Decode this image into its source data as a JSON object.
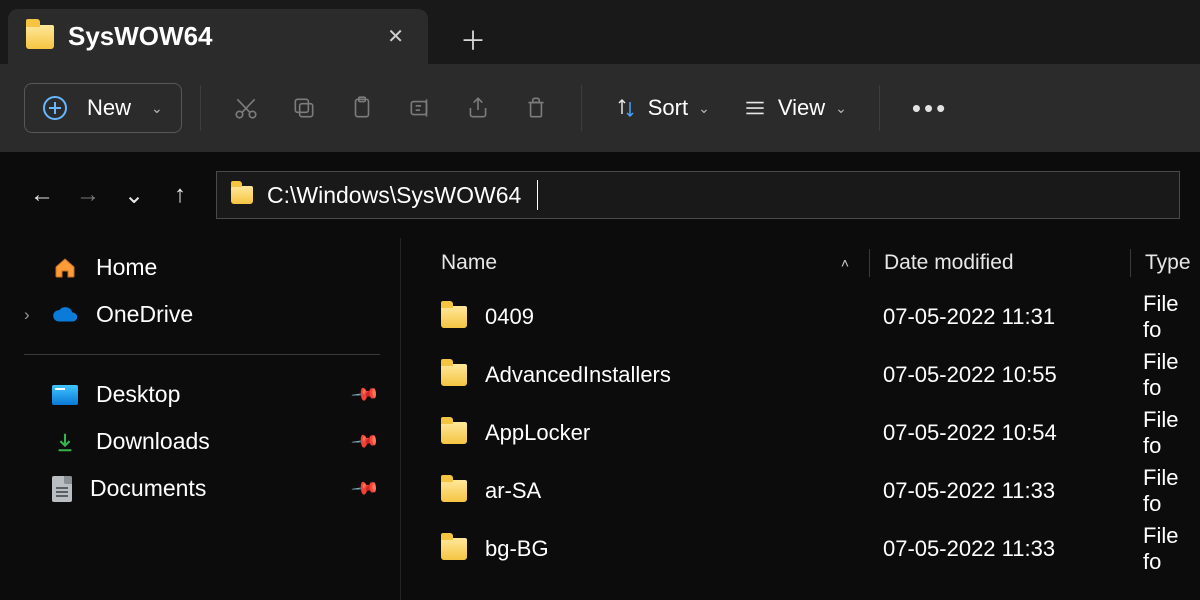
{
  "tab": {
    "title": "SysWOW64"
  },
  "toolbar": {
    "new_label": "New",
    "sort_label": "Sort",
    "view_label": "View"
  },
  "address": {
    "path": "C:\\Windows\\SysWOW64"
  },
  "sidebar": {
    "home": "Home",
    "onedrive": "OneDrive",
    "pinned": [
      {
        "label": "Desktop"
      },
      {
        "label": "Downloads"
      },
      {
        "label": "Documents"
      }
    ]
  },
  "headers": {
    "name": "Name",
    "date": "Date modified",
    "type": "Type"
  },
  "files": [
    {
      "name": "0409",
      "date": "07-05-2022 11:31",
      "type": "File fo"
    },
    {
      "name": "AdvancedInstallers",
      "date": "07-05-2022 10:55",
      "type": "File fo"
    },
    {
      "name": "AppLocker",
      "date": "07-05-2022 10:54",
      "type": "File fo"
    },
    {
      "name": "ar-SA",
      "date": "07-05-2022 11:33",
      "type": "File fo"
    },
    {
      "name": "bg-BG",
      "date": "07-05-2022 11:33",
      "type": "File fo"
    }
  ]
}
